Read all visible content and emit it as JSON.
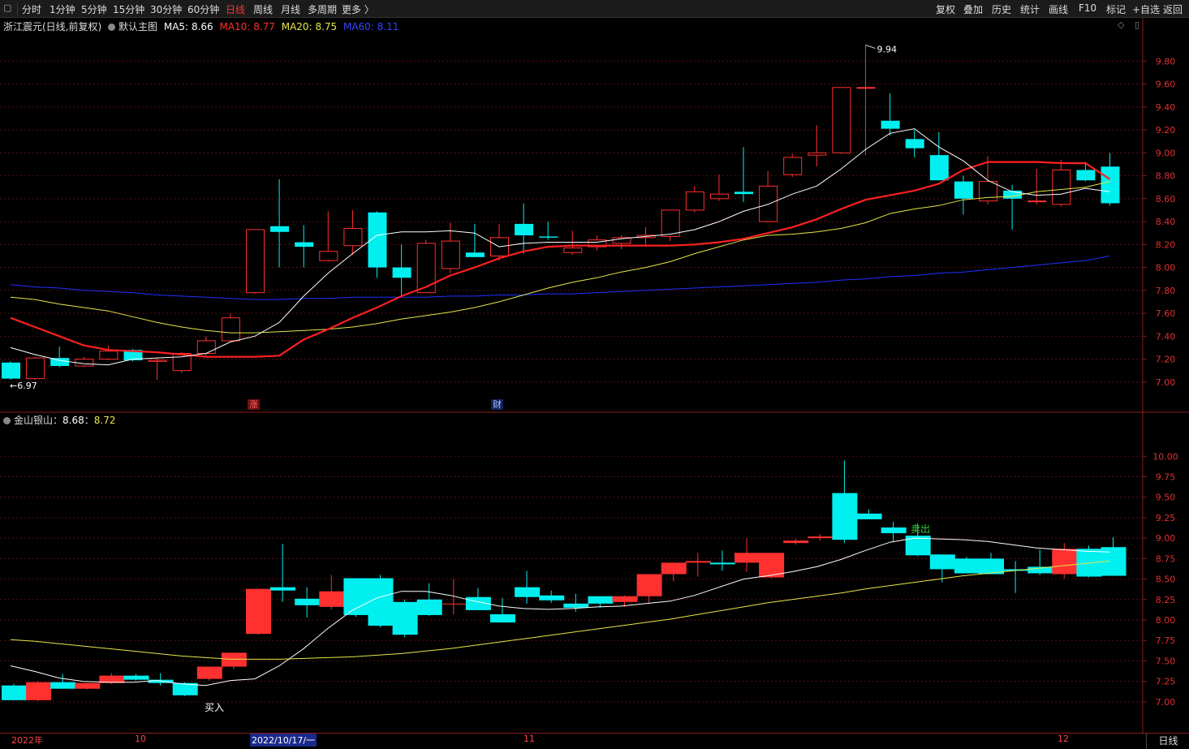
{
  "toolbar": {
    "left": [
      {
        "label": "分时",
        "active": false
      },
      {
        "label": "1分钟",
        "active": false
      },
      {
        "label": "5分钟",
        "active": false
      },
      {
        "label": "15分钟",
        "active": false
      },
      {
        "label": "30分钟",
        "active": false
      },
      {
        "label": "60分钟",
        "active": false
      },
      {
        "label": "日线",
        "active": true
      },
      {
        "label": "周线",
        "active": false
      },
      {
        "label": "月线",
        "active": false
      },
      {
        "label": "多周期",
        "active": false
      },
      {
        "label": "更多 〉",
        "active": false
      }
    ],
    "right": [
      "复权",
      "叠加",
      "历史",
      "统计",
      "画线",
      "F10",
      "标记",
      "+自选",
      "返回"
    ]
  },
  "main_info": {
    "stock": "浙江震元(日线,前复权)",
    "template": "默认主图",
    "ma5_label": "MA5:",
    "ma5": "8.66",
    "ma10_label": "MA10:",
    "ma10": "8.77",
    "ma20_label": "MA20:",
    "ma20": "8.75",
    "ma60_label": "MA60:",
    "ma60": "8.11"
  },
  "sub_info": {
    "name": "金山银山",
    "sep1": "：",
    "v1": "8.68",
    "sep2": "：",
    "v2": "8.72"
  },
  "annotations": {
    "high": "9.94",
    "low": "6.97",
    "badge_up": "涨",
    "badge_fin": "财",
    "buy": "买入",
    "sell": "卖出"
  },
  "x_labels": {
    "year": "2022年",
    "oct": "10",
    "selected": "2022/10/17/一",
    "nov": "11",
    "dec": "12"
  },
  "period": "日线",
  "colors": {
    "up": "#ff3030",
    "down": "#00f0f0",
    "ma5": "#ffffff",
    "ma10": "#ff2020",
    "ma20": "#e6e64a",
    "ma60": "#2030ff",
    "axis": "#8b1a1a",
    "grid": "#5a0f0f"
  },
  "chart_data": [
    {
      "type": "candlestick",
      "title": "浙江震元(日线,前复权)",
      "ylim": [
        6.85,
        10.05
      ],
      "yticks": [
        7.0,
        7.2,
        7.4,
        7.6,
        7.8,
        8.0,
        8.2,
        8.4,
        8.6,
        8.8,
        9.0,
        9.2,
        9.4,
        9.6,
        9.8
      ],
      "candles": [
        [
          7.17,
          7.18,
          7.02,
          7.03
        ],
        [
          7.03,
          7.22,
          7.02,
          7.21
        ],
        [
          7.21,
          7.31,
          7.13,
          7.14
        ],
        [
          7.14,
          7.22,
          7.13,
          7.2
        ],
        [
          7.2,
          7.32,
          7.19,
          7.27
        ],
        [
          7.28,
          7.29,
          7.18,
          7.19
        ],
        [
          7.18,
          7.21,
          7.02,
          7.19
        ],
        [
          7.1,
          7.26,
          7.08,
          7.25
        ],
        [
          7.25,
          7.4,
          7.22,
          7.36
        ],
        [
          7.36,
          7.6,
          7.35,
          7.56
        ],
        [
          7.78,
          8.33,
          7.77,
          8.33
        ],
        [
          8.36,
          8.77,
          8.0,
          8.31
        ],
        [
          8.22,
          8.37,
          8.0,
          8.18
        ],
        [
          8.06,
          8.49,
          8.05,
          8.14
        ],
        [
          8.19,
          8.5,
          8.11,
          8.34
        ],
        [
          8.48,
          8.49,
          7.91,
          8.0
        ],
        [
          8.0,
          8.2,
          7.76,
          7.91
        ],
        [
          7.78,
          8.24,
          7.78,
          8.21
        ],
        [
          7.99,
          8.39,
          7.95,
          8.23
        ],
        [
          8.13,
          8.38,
          8.09,
          8.09
        ],
        [
          8.1,
          8.38,
          8.06,
          8.26
        ],
        [
          8.38,
          8.56,
          8.12,
          8.28
        ],
        [
          8.27,
          8.4,
          8.24,
          8.26
        ],
        [
          8.13,
          8.32,
          8.11,
          8.17
        ],
        [
          8.18,
          8.28,
          8.15,
          8.24
        ],
        [
          8.21,
          8.28,
          8.16,
          8.26
        ],
        [
          8.26,
          8.35,
          8.18,
          8.28
        ],
        [
          8.27,
          8.5,
          8.23,
          8.5
        ],
        [
          8.5,
          8.71,
          8.48,
          8.66
        ],
        [
          8.6,
          8.81,
          8.58,
          8.64
        ],
        [
          8.66,
          9.05,
          8.57,
          8.64
        ],
        [
          8.4,
          8.84,
          8.39,
          8.71
        ],
        [
          8.81,
          8.99,
          8.79,
          8.96
        ],
        [
          8.98,
          9.24,
          8.88,
          9.0
        ],
        [
          9.0,
          9.42,
          8.99,
          9.57
        ],
        [
          9.57,
          9.94,
          8.98,
          9.57
        ],
        [
          9.28,
          9.52,
          9.15,
          9.21
        ],
        [
          9.12,
          9.2,
          8.96,
          9.04
        ],
        [
          8.98,
          9.18,
          8.78,
          8.76
        ],
        [
          8.75,
          8.8,
          8.46,
          8.6
        ],
        [
          8.58,
          8.97,
          8.55,
          8.75
        ],
        [
          8.67,
          8.72,
          8.33,
          8.6
        ],
        [
          8.58,
          8.86,
          8.55,
          8.58
        ],
        [
          8.55,
          8.94,
          8.53,
          8.85
        ],
        [
          8.85,
          8.92,
          8.75,
          8.76
        ],
        [
          8.88,
          9.0,
          8.54,
          8.56
        ]
      ],
      "ma5": [
        7.3,
        7.24,
        7.19,
        7.16,
        7.15,
        7.2,
        7.21,
        7.22,
        7.25,
        7.35,
        7.4,
        7.52,
        7.75,
        7.95,
        8.12,
        8.28,
        8.31,
        8.31,
        8.32,
        8.3,
        8.18,
        8.21,
        8.22,
        8.22,
        8.22,
        8.25,
        8.27,
        8.29,
        8.33,
        8.4,
        8.49,
        8.55,
        8.64,
        8.71,
        8.86,
        9.03,
        9.17,
        9.21,
        9.05,
        8.93,
        8.76,
        8.66,
        8.63,
        8.64,
        8.69,
        8.66
      ],
      "ma10": [
        7.56,
        7.48,
        7.4,
        7.32,
        7.28,
        7.27,
        7.26,
        7.24,
        7.22,
        7.22,
        7.22,
        7.23,
        7.37,
        7.46,
        7.56,
        7.65,
        7.75,
        7.83,
        7.93,
        8.0,
        8.08,
        8.14,
        8.18,
        8.19,
        8.19,
        8.19,
        8.19,
        8.19,
        8.2,
        8.22,
        8.25,
        8.3,
        8.35,
        8.42,
        8.51,
        8.59,
        8.63,
        8.67,
        8.73,
        8.85,
        8.92,
        8.92,
        8.92,
        8.91,
        8.91,
        8.77
      ],
      "ma20": [
        7.74,
        7.72,
        7.68,
        7.65,
        7.62,
        7.57,
        7.52,
        7.48,
        7.45,
        7.43,
        7.43,
        7.44,
        7.45,
        7.46,
        7.48,
        7.51,
        7.55,
        7.58,
        7.61,
        7.65,
        7.7,
        7.76,
        7.82,
        7.87,
        7.91,
        7.96,
        8.0,
        8.05,
        8.12,
        8.18,
        8.24,
        8.28,
        8.29,
        8.31,
        8.34,
        8.39,
        8.47,
        8.51,
        8.54,
        8.59,
        8.61,
        8.62,
        8.66,
        8.68,
        8.7,
        8.75
      ],
      "ma60": [
        7.85,
        7.83,
        7.82,
        7.8,
        7.79,
        7.78,
        7.76,
        7.75,
        7.74,
        7.73,
        7.72,
        7.72,
        7.73,
        7.73,
        7.74,
        7.74,
        7.74,
        7.74,
        7.75,
        7.75,
        7.76,
        7.76,
        7.77,
        7.77,
        7.78,
        7.79,
        7.8,
        7.81,
        7.82,
        7.83,
        7.84,
        7.85,
        7.86,
        7.87,
        7.89,
        7.9,
        7.92,
        7.93,
        7.95,
        7.96,
        7.98,
        8.0,
        8.02,
        8.04,
        8.06,
        8.1
      ]
    },
    {
      "type": "candlestick",
      "title": "金山银山",
      "ylim": [
        6.85,
        10.3
      ],
      "yticks": [
        7.0,
        7.25,
        7.5,
        7.75,
        8.0,
        8.25,
        8.5,
        8.75,
        9.0,
        9.25,
        9.5,
        9.75,
        10.0
      ],
      "candles": [
        [
          7.2,
          7.22,
          7.02,
          7.02
        ],
        [
          7.02,
          7.25,
          7.01,
          7.24
        ],
        [
          7.24,
          7.34,
          7.16,
          7.16
        ],
        [
          7.16,
          7.23,
          7.15,
          7.23
        ],
        [
          7.23,
          7.35,
          7.22,
          7.32
        ],
        [
          7.32,
          7.34,
          7.26,
          7.27
        ],
        [
          7.27,
          7.35,
          7.2,
          7.23
        ],
        [
          7.23,
          7.24,
          7.07,
          7.08
        ],
        [
          7.28,
          7.43,
          7.26,
          7.43
        ],
        [
          7.43,
          7.6,
          7.4,
          7.6
        ],
        [
          7.83,
          8.38,
          7.82,
          8.38
        ],
        [
          8.4,
          8.93,
          8.22,
          8.36
        ],
        [
          8.26,
          8.4,
          8.03,
          8.18
        ],
        [
          8.16,
          8.55,
          8.13,
          8.35
        ],
        [
          8.51,
          8.51,
          8.04,
          8.06
        ],
        [
          8.51,
          8.55,
          7.91,
          7.93
        ],
        [
          8.22,
          8.25,
          7.79,
          7.82
        ],
        [
          8.25,
          8.45,
          8.05,
          8.06
        ],
        [
          8.19,
          8.5,
          8.07,
          8.2
        ],
        [
          8.28,
          8.39,
          8.14,
          8.12
        ],
        [
          8.07,
          8.27,
          8.04,
          7.97
        ],
        [
          8.4,
          8.6,
          8.2,
          8.28
        ],
        [
          8.3,
          8.36,
          8.21,
          8.24
        ],
        [
          8.2,
          8.32,
          8.1,
          8.15
        ],
        [
          8.29,
          8.26,
          8.15,
          8.2
        ],
        [
          8.22,
          8.3,
          8.16,
          8.29
        ],
        [
          8.29,
          8.45,
          8.2,
          8.56
        ],
        [
          8.56,
          8.66,
          8.47,
          8.7
        ],
        [
          8.7,
          8.82,
          8.53,
          8.72
        ],
        [
          8.7,
          8.85,
          8.6,
          8.68
        ],
        [
          8.7,
          9.0,
          8.59,
          8.82
        ],
        [
          8.52,
          8.82,
          8.51,
          8.82
        ],
        [
          8.94,
          8.99,
          8.92,
          8.97
        ],
        [
          9.0,
          9.05,
          8.97,
          9.02
        ],
        [
          9.55,
          9.95,
          8.94,
          8.98
        ],
        [
          9.3,
          9.35,
          9.23,
          9.23
        ],
        [
          9.13,
          9.2,
          8.96,
          9.06
        ],
        [
          9.03,
          9.18,
          8.78,
          8.79
        ],
        [
          8.8,
          8.8,
          8.46,
          8.62
        ],
        [
          8.75,
          8.77,
          8.57,
          8.57
        ],
        [
          8.75,
          8.82,
          8.56,
          8.56
        ],
        [
          8.62,
          8.72,
          8.33,
          8.6
        ],
        [
          8.65,
          8.86,
          8.55,
          8.57
        ],
        [
          8.56,
          8.94,
          8.51,
          8.87
        ],
        [
          8.87,
          8.91,
          8.52,
          8.53
        ],
        [
          8.89,
          9.01,
          8.54,
          8.54
        ]
      ],
      "ma_white": [
        7.44,
        7.37,
        7.29,
        7.25,
        7.24,
        7.24,
        7.26,
        7.22,
        7.2,
        7.26,
        7.28,
        7.44,
        7.65,
        7.9,
        8.12,
        8.27,
        8.35,
        8.35,
        8.3,
        8.23,
        8.17,
        8.14,
        8.13,
        8.14,
        8.16,
        8.17,
        8.2,
        8.23,
        8.3,
        8.4,
        8.5,
        8.54,
        8.59,
        8.65,
        8.74,
        8.85,
        8.95,
        9.0,
        8.99,
        8.98,
        8.96,
        8.92,
        8.88,
        8.86,
        8.84,
        8.83
      ],
      "ma_yellow": [
        7.76,
        7.74,
        7.71,
        7.68,
        7.65,
        7.62,
        7.59,
        7.56,
        7.54,
        7.52,
        7.52,
        7.52,
        7.53,
        7.54,
        7.55,
        7.57,
        7.59,
        7.62,
        7.65,
        7.69,
        7.73,
        7.77,
        7.81,
        7.85,
        7.89,
        7.93,
        7.97,
        8.01,
        8.06,
        8.11,
        8.16,
        8.21,
        8.25,
        8.29,
        8.33,
        8.38,
        8.42,
        8.46,
        8.5,
        8.54,
        8.57,
        8.6,
        8.63,
        8.66,
        8.69,
        8.72
      ]
    }
  ]
}
